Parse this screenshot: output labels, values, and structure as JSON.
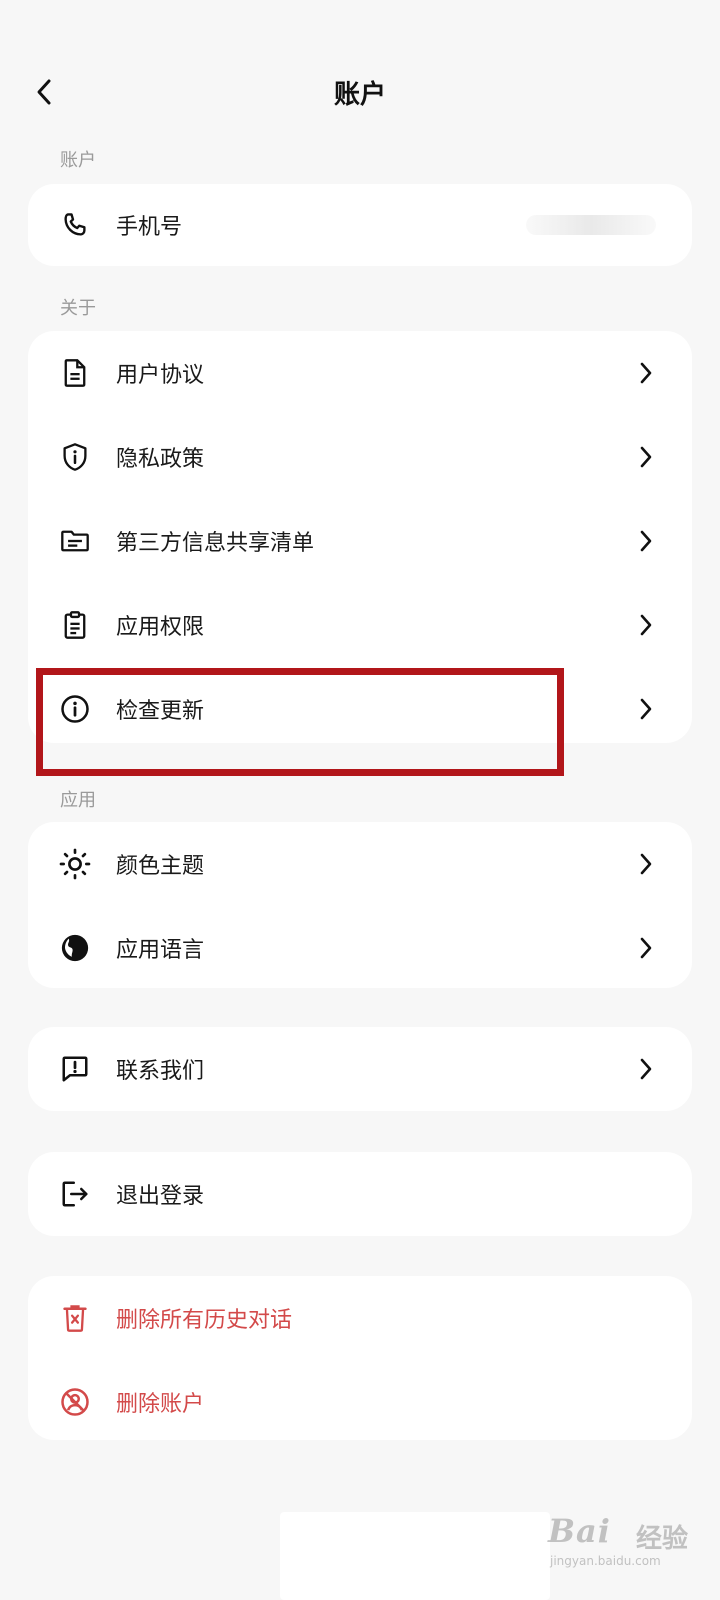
{
  "header": {
    "title": "账户",
    "back_icon": "chevron-left-icon"
  },
  "sections": {
    "account": "账户",
    "about": "关于",
    "app": "应用"
  },
  "account_card": {
    "phone": {
      "label": "手机号",
      "icon": "phone-icon"
    }
  },
  "about_card": [
    {
      "label": "用户协议",
      "icon": "document-icon"
    },
    {
      "label": "隐私政策",
      "icon": "shield-info-icon"
    },
    {
      "label": "第三方信息共享清单",
      "icon": "folder-list-icon"
    },
    {
      "label": "应用权限",
      "icon": "clipboard-icon"
    },
    {
      "label": "检查更新",
      "icon": "info-circle-icon"
    }
  ],
  "app_card": [
    {
      "label": "颜色主题",
      "icon": "sun-icon"
    },
    {
      "label": "应用语言",
      "icon": "globe-icon"
    }
  ],
  "contact_card": {
    "label": "联系我们",
    "icon": "feedback-icon"
  },
  "logout_card": {
    "label": "退出登录",
    "icon": "logout-icon"
  },
  "danger_card": [
    {
      "label": "删除所有历史对话",
      "icon": "trash-icon"
    },
    {
      "label": "删除账户",
      "icon": "account-delete-icon"
    }
  ],
  "watermark": {
    "main": "Bai",
    "cn": "经验",
    "sub": "jingyan.baidu.com"
  },
  "colors": {
    "background": "#f7f7f7",
    "card": "#ffffff",
    "danger": "#d34a4a",
    "highlight": "#b2161a",
    "section_label": "#9a9a9a"
  }
}
